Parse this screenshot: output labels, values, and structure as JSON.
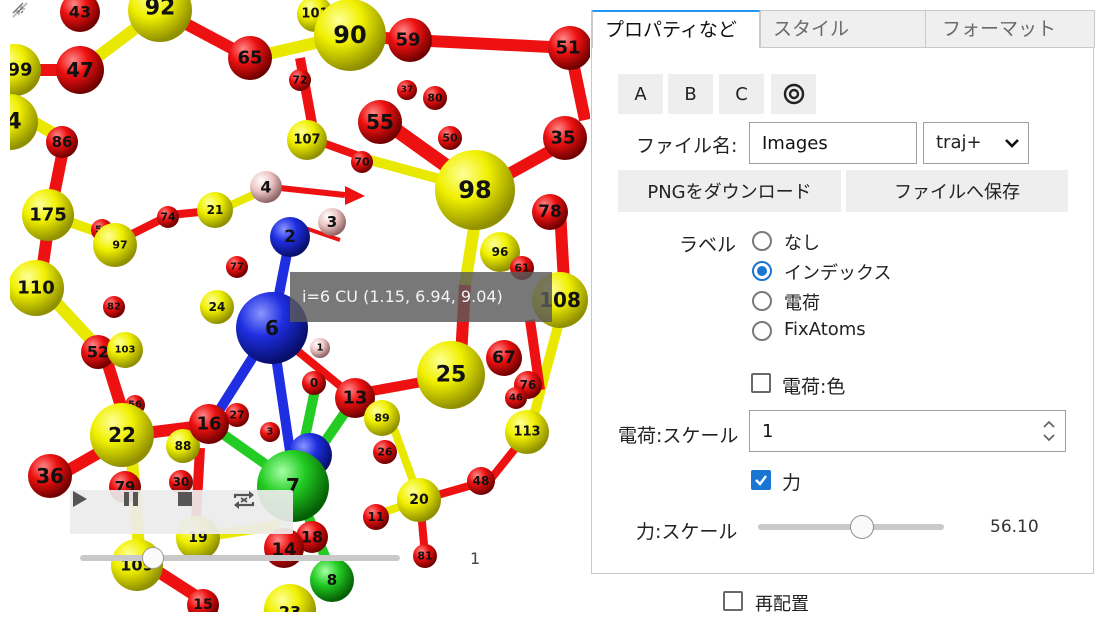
{
  "viewer": {
    "tooltip": "i=6 CU (1.15, 6.94, 9.04)",
    "frame_value": "1",
    "player": {
      "play_icon": "play-icon",
      "pause_icon": "pause-icon",
      "stop_icon": "stop-icon",
      "repeat_icon": "repeat-icon"
    },
    "atom_colors": {
      "O": "#ee1111",
      "S": "#e8e800",
      "N": "#1e2ee0",
      "H": "#e8b4b4",
      "CU": "#22cc22"
    },
    "atom_labels": [
      "43",
      "92",
      "101",
      "90",
      "59",
      "51",
      "99",
      "47",
      "65",
      "72",
      "80",
      "37",
      "55",
      "50",
      "4",
      "86",
      "107",
      "70",
      "35",
      "98",
      "175",
      "54",
      "74",
      "21",
      "4",
      "3",
      "2",
      "78",
      "97",
      "96",
      "61",
      "110",
      "4",
      "77",
      "24",
      "82",
      "6",
      "108",
      "52",
      "103",
      "1",
      "67",
      "25",
      "76",
      "0",
      "13",
      "89",
      "46",
      "113",
      "56",
      "22",
      "88",
      "27",
      "3",
      "16",
      "26",
      "36",
      "79",
      "30",
      "7",
      "48",
      "20",
      "11",
      "19",
      "15",
      "109",
      "18",
      "14",
      "81",
      "8",
      "23"
    ]
  },
  "panel": {
    "tabs": [
      "プロパティなど",
      "スタイル",
      "フォーマット"
    ],
    "view_buttons": [
      "A",
      "B",
      "C"
    ],
    "target_icon": "target-icon",
    "filename_label": "ファイル名:",
    "filename_value": "Images",
    "format_value": "traj+",
    "download_png": "PNGをダウンロード",
    "save_file": "ファイルへ保存",
    "label_caption": "ラベル",
    "label_options": [
      "なし",
      "インデックス",
      "電荷",
      "FixAtoms"
    ],
    "label_selected": "インデックス",
    "charge_color_label": "電荷:色",
    "charge_color_checked": false,
    "charge_scale_label": "電荷:スケール",
    "charge_scale_value": "1",
    "force_label": "力",
    "force_checked": true,
    "force_scale_label": "力:スケール",
    "force_scale_value": "56.10",
    "force_scale_fraction": 0.56
  },
  "rearrange_label": "再配置",
  "rearrange_checked": false
}
